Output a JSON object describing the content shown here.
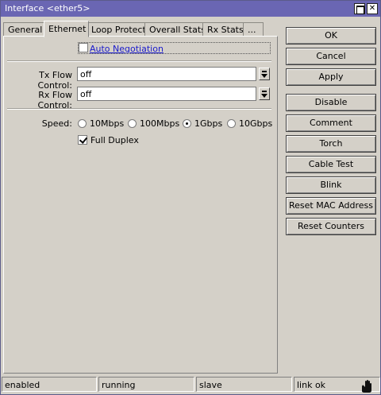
{
  "window": {
    "title": "Interface <ether5>"
  },
  "tabs": [
    {
      "label": "General",
      "active": false
    },
    {
      "label": "Ethernet",
      "active": true
    },
    {
      "label": "Loop Protect",
      "active": false
    },
    {
      "label": "Overall Stats",
      "active": false
    },
    {
      "label": "Rx Stats",
      "active": false
    },
    {
      "label": "...",
      "active": false
    }
  ],
  "ethernet": {
    "auto_negotiation": {
      "label": "Auto Negotiation",
      "checked": false
    },
    "tx_flow_control": {
      "label": "Tx Flow Control:",
      "value": "off"
    },
    "rx_flow_control": {
      "label": "Rx Flow Control:",
      "value": "off"
    },
    "speed": {
      "label": "Speed:",
      "options": [
        "10Mbps",
        "100Mbps",
        "1Gbps",
        "10Gbps"
      ],
      "selected": "1Gbps"
    },
    "full_duplex": {
      "label": "Full Duplex",
      "checked": true
    }
  },
  "buttons": {
    "ok": "OK",
    "cancel": "Cancel",
    "apply": "Apply",
    "disable": "Disable",
    "comment": "Comment",
    "torch": "Torch",
    "cable_test": "Cable Test",
    "blink": "Blink",
    "reset_mac": "Reset MAC Address",
    "reset_counters": "Reset Counters"
  },
  "status": [
    "enabled",
    "running",
    "slave",
    "link ok"
  ],
  "colors": {
    "titlebar": "#6a66b3",
    "window_bg": "#d4d0c8",
    "link": "#1a1acc"
  }
}
